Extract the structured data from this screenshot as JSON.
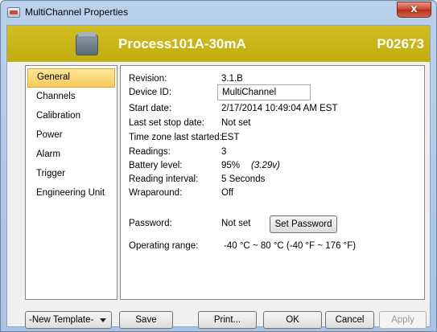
{
  "window": {
    "title": "MultiChannel Properties",
    "close_glyph": "x"
  },
  "header": {
    "device_name": "Process101A-30mA",
    "serial": "P02673",
    "accent_color": "#c9b417"
  },
  "nav": {
    "items": [
      {
        "label": "General",
        "selected": true
      },
      {
        "label": "Channels"
      },
      {
        "label": "Calibration"
      },
      {
        "label": "Power"
      },
      {
        "label": "Alarm"
      },
      {
        "label": "Trigger"
      },
      {
        "label": "Engineering Unit"
      }
    ]
  },
  "general": {
    "revision_label": "Revision:",
    "revision": "3.1.B",
    "device_id_label": "Device ID:",
    "device_id": "MultiChannel",
    "start_date_label": "Start date:",
    "start_date": "2/17/2014 10:49:04 AM EST",
    "stop_date_label": "Last set stop date:",
    "stop_date": "Not set",
    "tz_label": "Time zone last started:",
    "tz": "EST",
    "readings_label": "Readings:",
    "readings": "3",
    "battery_label": "Battery level:",
    "battery": "95%",
    "battery_volts": "(3.29v)",
    "interval_label": "Reading interval:",
    "interval": "5 Seconds",
    "wrap_label": "Wraparound:",
    "wrap": "Off",
    "password_label": "Password:",
    "password": "Not set",
    "set_password_label": "Set Password",
    "range_label": "Operating range:",
    "range": "-40 °C ~ 80 °C (-40 °F ~ 176 °F)"
  },
  "footer": {
    "template_value": "-New Template-",
    "save_label": "Save",
    "print_label": "Print...",
    "ok_label": "OK",
    "cancel_label": "Cancel",
    "apply_label": "Apply"
  },
  "icons": {
    "window_icon": "window-app-icon",
    "device_icon": "device-logger-icon",
    "close_icon": "close-icon",
    "caret_icon": "chevron-down-icon"
  }
}
